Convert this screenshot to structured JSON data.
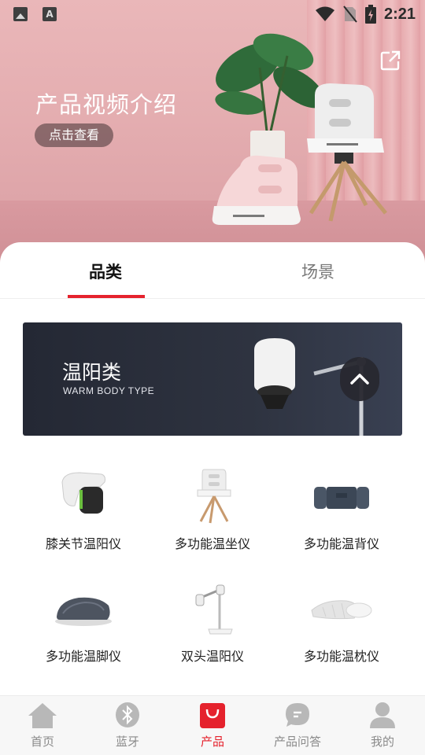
{
  "status_bar": {
    "time": "2:21",
    "left_icons": [
      "image-icon",
      "text-a-icon"
    ],
    "right_icons": [
      "wifi-icon",
      "no-sim-icon",
      "battery-charging-icon"
    ]
  },
  "hero": {
    "title": "产品视频介绍",
    "button_label": "点击查看",
    "share_icon": "share-icon"
  },
  "tabs": [
    {
      "label": "品类",
      "active": true
    },
    {
      "label": "场景",
      "active": false
    }
  ],
  "banner": {
    "title": "温阳类",
    "subtitle": "WARM BODY TYPE",
    "scroll_icon": "chevron-up-icon"
  },
  "products": [
    {
      "label": "膝关节温阳仪",
      "icon": "knee-device-icon"
    },
    {
      "label": "多功能温坐仪",
      "icon": "seat-device-icon"
    },
    {
      "label": "多功能温背仪",
      "icon": "back-device-icon"
    },
    {
      "label": "多功能温脚仪",
      "icon": "foot-device-icon"
    },
    {
      "label": "双头温阳仪",
      "icon": "dual-head-device-icon"
    },
    {
      "label": "多功能温枕仪",
      "icon": "pillow-device-icon"
    }
  ],
  "bottom_nav": [
    {
      "label": "首页",
      "icon": "home-icon",
      "active": false
    },
    {
      "label": "蓝牙",
      "icon": "bluetooth-icon",
      "active": false
    },
    {
      "label": "产品",
      "icon": "shopping-bag-icon",
      "active": true
    },
    {
      "label": "产品问答",
      "icon": "chat-icon",
      "active": false
    },
    {
      "label": "我的",
      "icon": "user-icon",
      "active": false
    }
  ],
  "colors": {
    "accent": "#e5222d",
    "hero_pink": "#e4adb0",
    "banner_dark": "#2b2f3b",
    "inactive_nav": "#8a8a8a"
  }
}
